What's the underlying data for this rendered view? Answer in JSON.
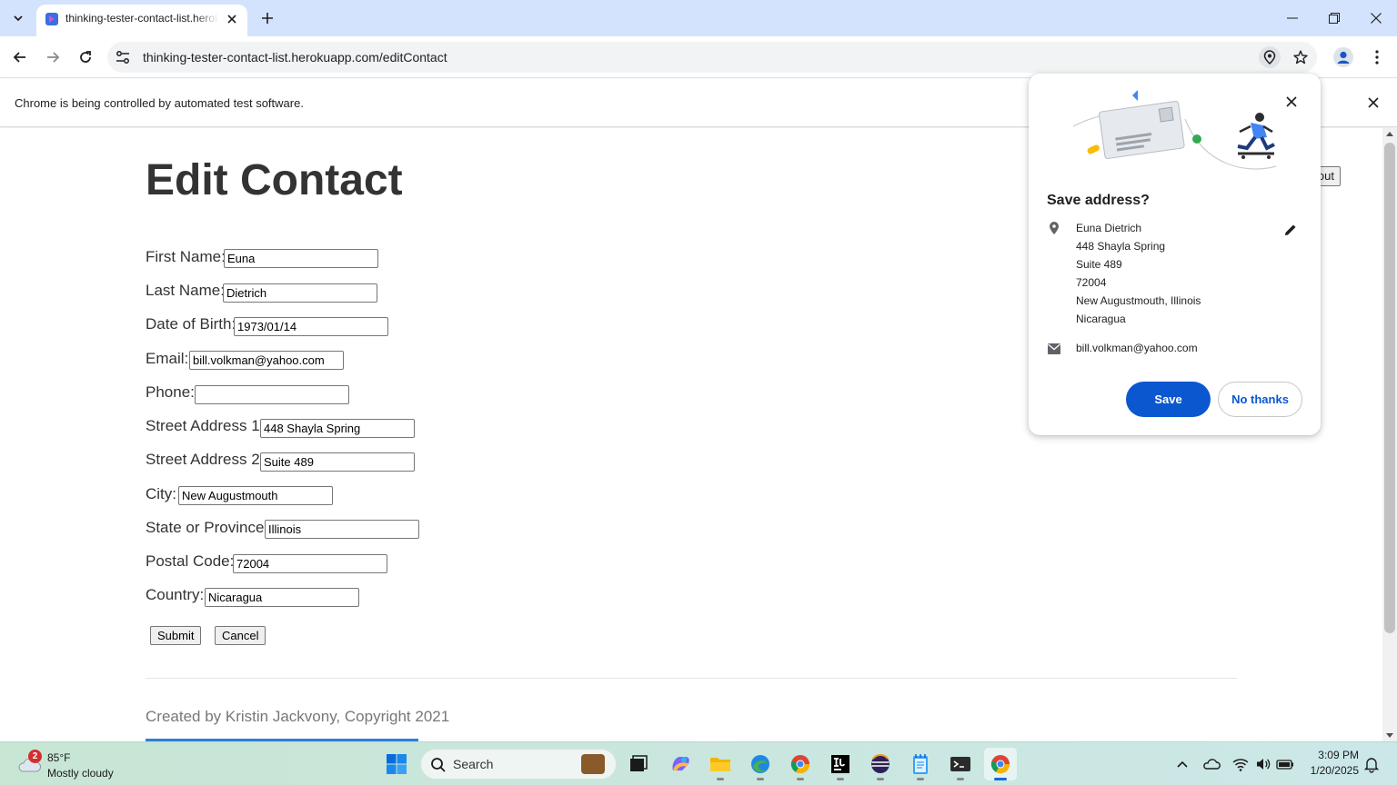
{
  "browser": {
    "tab_title": "thinking-tester-contact-list.herokuapp.com/editContact",
    "url": "thinking-tester-contact-list.herokuapp.com/editContact",
    "infobar_text": "Chrome is being controlled by automated test software."
  },
  "page": {
    "title": "Edit Contact",
    "fields": [
      {
        "label": "First Name:",
        "value": "Euna"
      },
      {
        "label": "Last Name:",
        "value": "Dietrich"
      },
      {
        "label": "Date of Birth:",
        "value": "1973/01/14"
      },
      {
        "label": "Email:",
        "value": "bill.volkman@yahoo.com"
      },
      {
        "label": "Phone:",
        "value": ""
      },
      {
        "label": "Street Address 1:",
        "value": "448 Shayla Spring"
      },
      {
        "label": "Street Address 2:",
        "value": "Suite 489"
      },
      {
        "label": "City:",
        "value": "New Augustmouth"
      },
      {
        "label": "State or Province:",
        "value": "Illinois"
      },
      {
        "label": "Postal Code:",
        "value": "72004"
      },
      {
        "label": "Country:",
        "value": "Nicaragua"
      }
    ],
    "submit_label": "Submit",
    "cancel_label": "Cancel",
    "logout_partial": "out",
    "footer": "Created by Kristin Jackvony, Copyright 2021"
  },
  "save_address_popup": {
    "title": "Save address?",
    "address_lines": [
      "Euna Dietrich",
      "448 Shayla Spring",
      "Suite 489",
      "72004",
      "New Augustmouth, Illinois",
      "Nicaragua"
    ],
    "email": "bill.volkman@yahoo.com",
    "save_label": "Save",
    "no_thanks_label": "No thanks",
    "accent_color": "#0b57d0"
  },
  "taskbar": {
    "weather_badge": "2",
    "weather_temp": "85°F",
    "weather_desc": "Mostly cloudy",
    "search_label": "Search",
    "time": "3:09 PM",
    "date": "1/20/2025",
    "apps": [
      "file-explorer-icon",
      "copilot-icon",
      "folder-icon",
      "edge-icon",
      "chrome-icon",
      "intellij-icon",
      "eclipse-icon",
      "notepad-icon",
      "terminal-icon",
      "chrome-active-icon"
    ]
  }
}
